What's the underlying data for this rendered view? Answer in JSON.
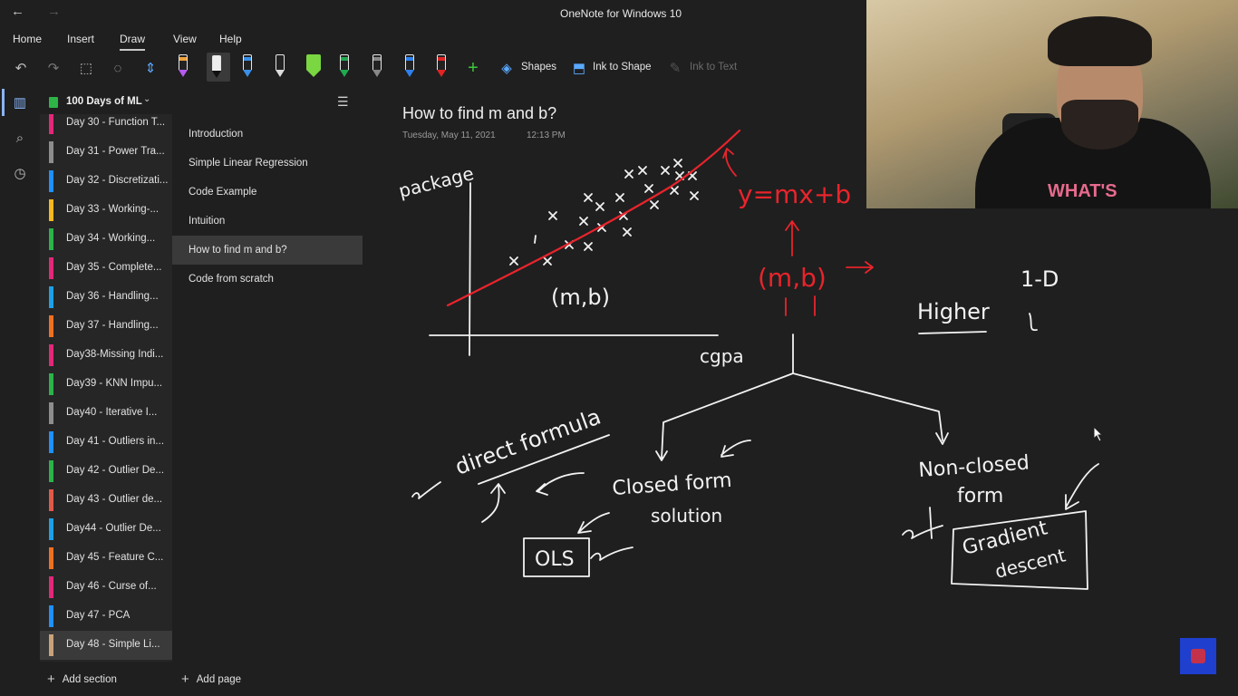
{
  "app": {
    "title": "OneNote for Windows 10",
    "nav_back": "←",
    "nav_forward": "→"
  },
  "menu": [
    {
      "label": "Home"
    },
    {
      "label": "Insert"
    },
    {
      "label": "Draw",
      "active": true
    },
    {
      "label": "View"
    },
    {
      "label": "Help"
    }
  ],
  "toolbar": {
    "shapes_label": "Shapes",
    "ink_to_shape_label": "Ink to Shape",
    "ink_to_text_label": "Ink to Text",
    "pen_colors": [
      "#f2a33a",
      "#111111",
      "#3a8fe8",
      "#222222",
      "#3cc83c",
      "#1faa4f",
      "#888888",
      "#2f80ed",
      "#e02424"
    ],
    "highlighter_colors": [
      "#7ad641"
    ]
  },
  "notebook": {
    "name": "100 Days of ML"
  },
  "sections": [
    {
      "label": "Day 30 - Function T...",
      "color": "#e3287a"
    },
    {
      "label": "Day 31 - Power Tra...",
      "color": "#8d8d8d"
    },
    {
      "label": "Day 32 - Discretizati...",
      "color": "#1e90ff"
    },
    {
      "label": "Day 33 - Working-...",
      "color": "#f6b81e"
    },
    {
      "label": "Day 34 - Working...",
      "color": "#2bb34a"
    },
    {
      "label": "Day 35 - Complete...",
      "color": "#e3287a"
    },
    {
      "label": "Day 36 - Handling...",
      "color": "#1ea0e8"
    },
    {
      "label": "Day 37 - Handling...",
      "color": "#f07020"
    },
    {
      "label": "Day38-Missing Indi...",
      "color": "#e3287a"
    },
    {
      "label": "Day39 - KNN Impu...",
      "color": "#2bb34a"
    },
    {
      "label": "Day40 - Iterative I...",
      "color": "#8d8d8d"
    },
    {
      "label": "Day 41 - Outliers in...",
      "color": "#1e90ff"
    },
    {
      "label": "Day 42 - Outlier De...",
      "color": "#2bb34a"
    },
    {
      "label": "Day 43 - Outlier de...",
      "color": "#e05a4a"
    },
    {
      "label": "Day44 - Outlier De...",
      "color": "#1ea0e8"
    },
    {
      "label": "Day 45 - Feature C...",
      "color": "#f07020"
    },
    {
      "label": "Day 46 - Curse of...",
      "color": "#e3287a"
    },
    {
      "label": "Day 47 - PCA",
      "color": "#1e90ff"
    },
    {
      "label": "Day 48 - Simple Li...",
      "color": "#c8a27a",
      "selected": true
    }
  ],
  "pages": [
    {
      "label": "Introduction"
    },
    {
      "label": "Simple Linear Regression"
    },
    {
      "label": "Code Example"
    },
    {
      "label": "Intuition"
    },
    {
      "label": "How to find m and b?",
      "selected": true
    },
    {
      "label": "Code from scratch"
    }
  ],
  "footer": {
    "add_section": "Add section",
    "add_page": "Add page"
  },
  "page": {
    "title": "How to find m and b?",
    "date": "Tuesday, May 11, 2021",
    "time": "12:13 PM",
    "ink_text": {
      "ylabel": "package",
      "xlabel": "cgpa",
      "mb": "(m,b)",
      "equation": "y=mx+b",
      "mb_red": "(m,b)",
      "higher": "Higher",
      "one_d": "1-D",
      "direct_formula": "direct formula",
      "closed_form": "Closed form",
      "solution": "solution",
      "ols": "OLS",
      "non_closed": "Non-closed",
      "form": "form",
      "gradient": "Gradient",
      "descent": "descent"
    }
  },
  "webcam": {
    "shirt_text": "WHAT'S"
  }
}
